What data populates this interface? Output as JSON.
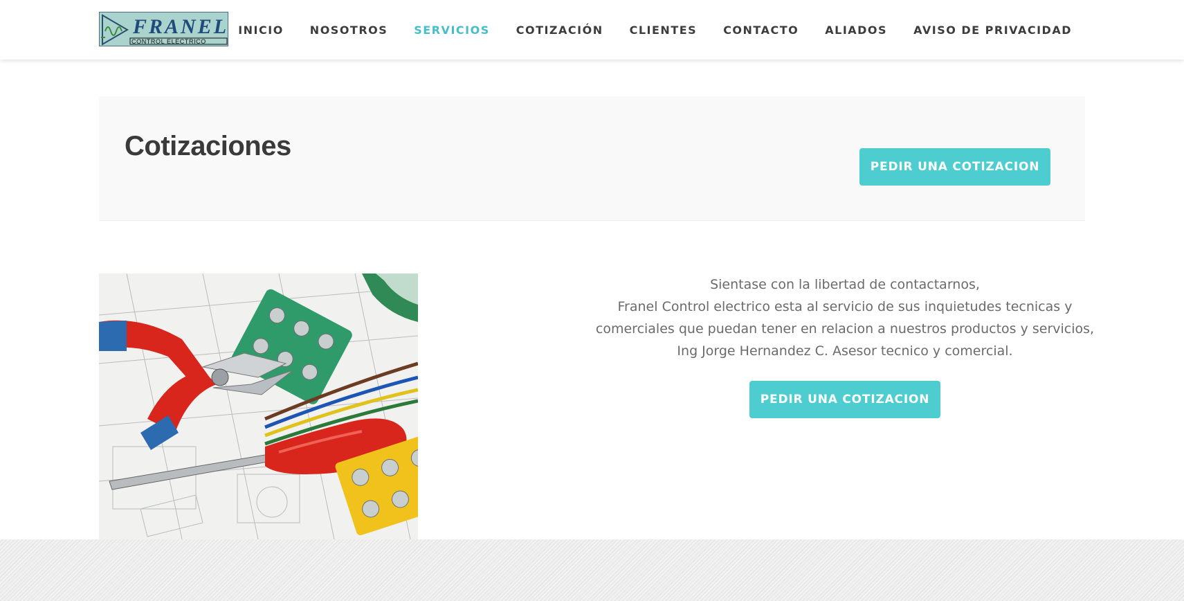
{
  "header": {
    "logo": {
      "brand": "FRANEL",
      "tagline": "CONTROL ELECTRICO"
    },
    "nav": [
      {
        "label": "INICIO",
        "active": false
      },
      {
        "label": "NOSOTROS",
        "active": false
      },
      {
        "label": "SERVICIOS",
        "active": true
      },
      {
        "label": "COTIZACIÓN",
        "active": false
      },
      {
        "label": "CLIENTES",
        "active": false
      },
      {
        "label": "CONTACTO",
        "active": false
      },
      {
        "label": "ALIADOS",
        "active": false
      },
      {
        "label": "AVISO DE PRIVACIDAD",
        "active": false
      }
    ]
  },
  "banner": {
    "title": "Cotizaciones",
    "button_label": "PEDIR UNA COTIZACION"
  },
  "content": {
    "image_icon": "electrical-tools-photo",
    "lines": [
      "Sientase con la libertad de contactarnos,",
      "Franel Control electrico esta al servicio de sus inquietudes tecnicas y",
      "comerciales que puedan tener en relacion a nuestros productos y servicios,",
      "Ing Jorge Hernandez C. Asesor tecnico y comercial."
    ],
    "button_label": "PEDIR UNA COTIZACION"
  },
  "colors": {
    "accent": "#44bfc7",
    "button": "#4ecdd0",
    "text": "#3c3c3c"
  }
}
